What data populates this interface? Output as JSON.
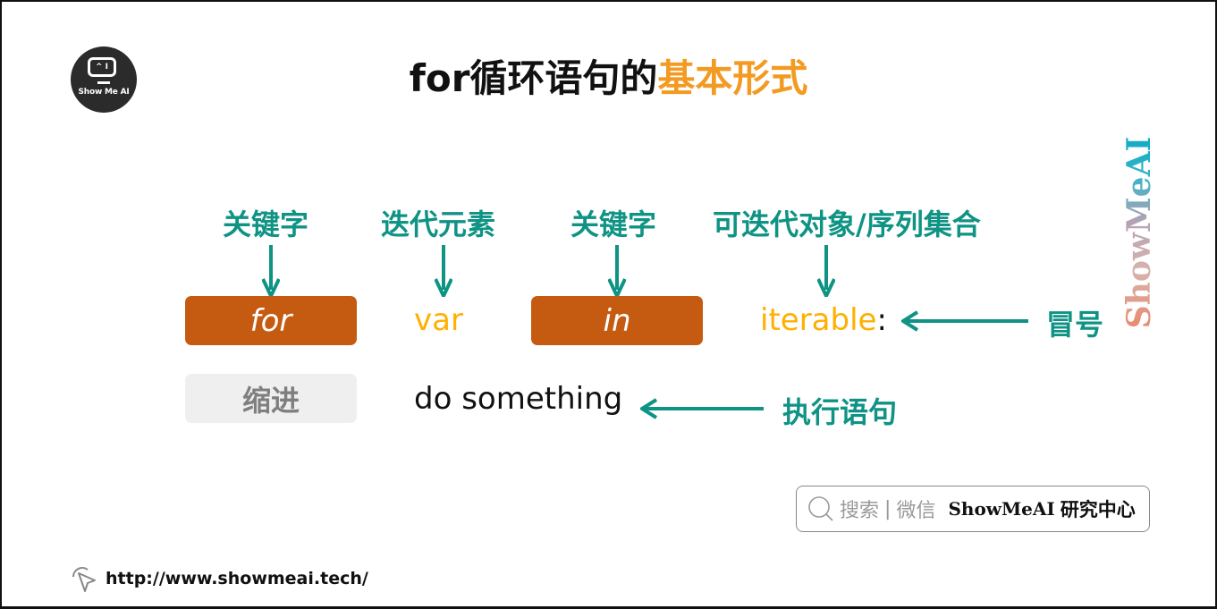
{
  "logo": {
    "eyes": "^ I",
    "text": "Show Me AI"
  },
  "title": {
    "main": "for循环语句的",
    "highlight": "基本形式"
  },
  "colors": {
    "teal": "#0e9384",
    "orange_box": "#c55a11",
    "code_yellow": "#ffb000",
    "title_orange": "#f29a21"
  },
  "annotations": {
    "keyword_1": "关键字",
    "iter_element": "迭代元素",
    "keyword_2": "关键字",
    "iterable_obj": "可迭代对象/序列集合",
    "colon": "冒号",
    "exec_stmt": "执行语句"
  },
  "code": {
    "for_kw": "for",
    "var": "var",
    "in_kw": "in",
    "iterable": "iterable",
    "colon": ":",
    "indent": "缩进",
    "body": "do something"
  },
  "side_brand": "ShowMeAI",
  "search": {
    "search": "搜索",
    "sep": "|",
    "wechat": "微信",
    "brand": "ShowMeAI",
    "center": "研究中心"
  },
  "footer": {
    "url": "http://www.showmeai.tech/"
  }
}
